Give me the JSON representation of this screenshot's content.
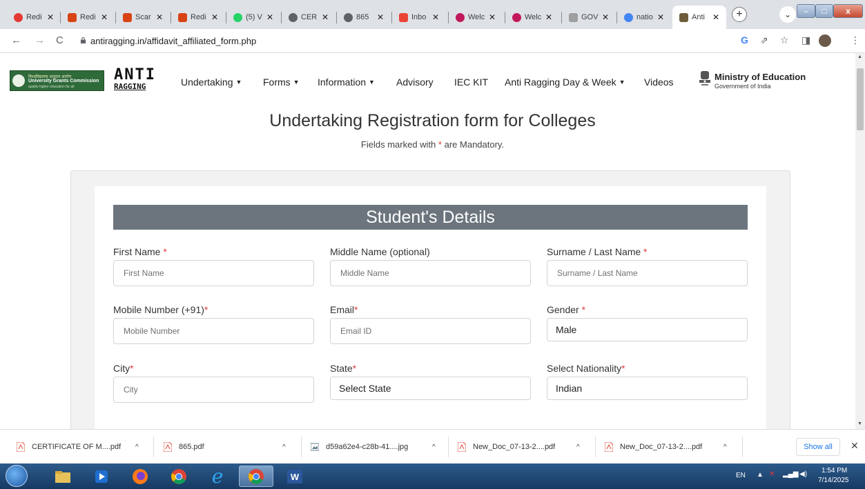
{
  "browser": {
    "tabs": [
      {
        "label": "Redi",
        "icon_color": "#e53935"
      },
      {
        "label": "Redi",
        "icon_color": "#d84315"
      },
      {
        "label": "Scar",
        "icon_color": "#d84315"
      },
      {
        "label": "Redi",
        "icon_color": "#d84315"
      },
      {
        "label": "(5) V",
        "icon_color": "#25d366"
      },
      {
        "label": "CER",
        "icon_color": "#5f6368"
      },
      {
        "label": "865",
        "icon_color": "#5f6368"
      },
      {
        "label": "Inbo",
        "icon_color": "#ea4335"
      },
      {
        "label": "Welc",
        "icon_color": "#c2185b"
      },
      {
        "label": "Welc",
        "icon_color": "#c2185b"
      },
      {
        "label": "GOV",
        "icon_color": "#9e9e9e"
      },
      {
        "label": "natio",
        "icon_color": "#4285f4"
      },
      {
        "label": "Anti",
        "icon_color": "#6d5d3a"
      }
    ],
    "url": "antiragging.in/affidavit_affiliated_form.php"
  },
  "site": {
    "ugc": {
      "line1": "विश्वविद्यालय अनुदान आयोग",
      "line2": "University Grants Commission",
      "line3": "quality higher education for all"
    },
    "anti_logo": {
      "top": "ANTI",
      "bottom": "RAGGING"
    },
    "menu": [
      {
        "label": "Undertaking",
        "dropdown": true
      },
      {
        "label": "Forms",
        "dropdown": true
      },
      {
        "label": "Information",
        "dropdown": true
      },
      {
        "label": "Advisory",
        "dropdown": false
      },
      {
        "label": "IEC KIT",
        "dropdown": false
      },
      {
        "label": "Anti Ragging Day & Week",
        "dropdown": true
      },
      {
        "label": "Videos",
        "dropdown": false
      }
    ],
    "ministry": {
      "name": "Ministry of Education",
      "sub": "Government of India"
    }
  },
  "form": {
    "title": "Undertaking Registration form for Colleges",
    "mandatory_prefix": "Fields marked with",
    "mandatory_star": "*",
    "mandatory_suffix": "are Mandatory.",
    "section_title": "Student's Details",
    "fields": {
      "first_name": {
        "label": "First Name",
        "required": " *",
        "placeholder": "First Name"
      },
      "middle_name": {
        "label": "Middle Name (optional)",
        "required": "",
        "placeholder": "Middle Name"
      },
      "last_name": {
        "label": "Surname / Last Name",
        "required": " *",
        "placeholder": "Surname / Last Name"
      },
      "mobile": {
        "label": "Mobile Number (+91)",
        "required": "*",
        "placeholder": "Mobile Number"
      },
      "email": {
        "label": "Email",
        "required": "*",
        "placeholder": "Email ID"
      },
      "gender": {
        "label": "Gender",
        "required": " *",
        "value": "Male"
      },
      "city": {
        "label": "City",
        "required": "*",
        "placeholder": "City"
      },
      "state": {
        "label": "State",
        "required": "*",
        "value": "Select State"
      },
      "nationality": {
        "label": "Select Nationality",
        "required": "*",
        "value": "Indian"
      }
    }
  },
  "downloads": {
    "items": [
      "CERTIFICATE OF M....pdf",
      "865.pdf",
      "d59a62e4-c28b-41....jpg",
      "New_Doc_07-13-2....pdf",
      "New_Doc_07-13-2....pdf"
    ],
    "show_all": "Show all"
  },
  "taskbar": {
    "lang": "EN",
    "time": "1:54 PM",
    "date": "7/14/2025"
  },
  "colors": {
    "section_band": "#6c757d",
    "required": "#e03b3b",
    "accent": "#1a73e8"
  }
}
